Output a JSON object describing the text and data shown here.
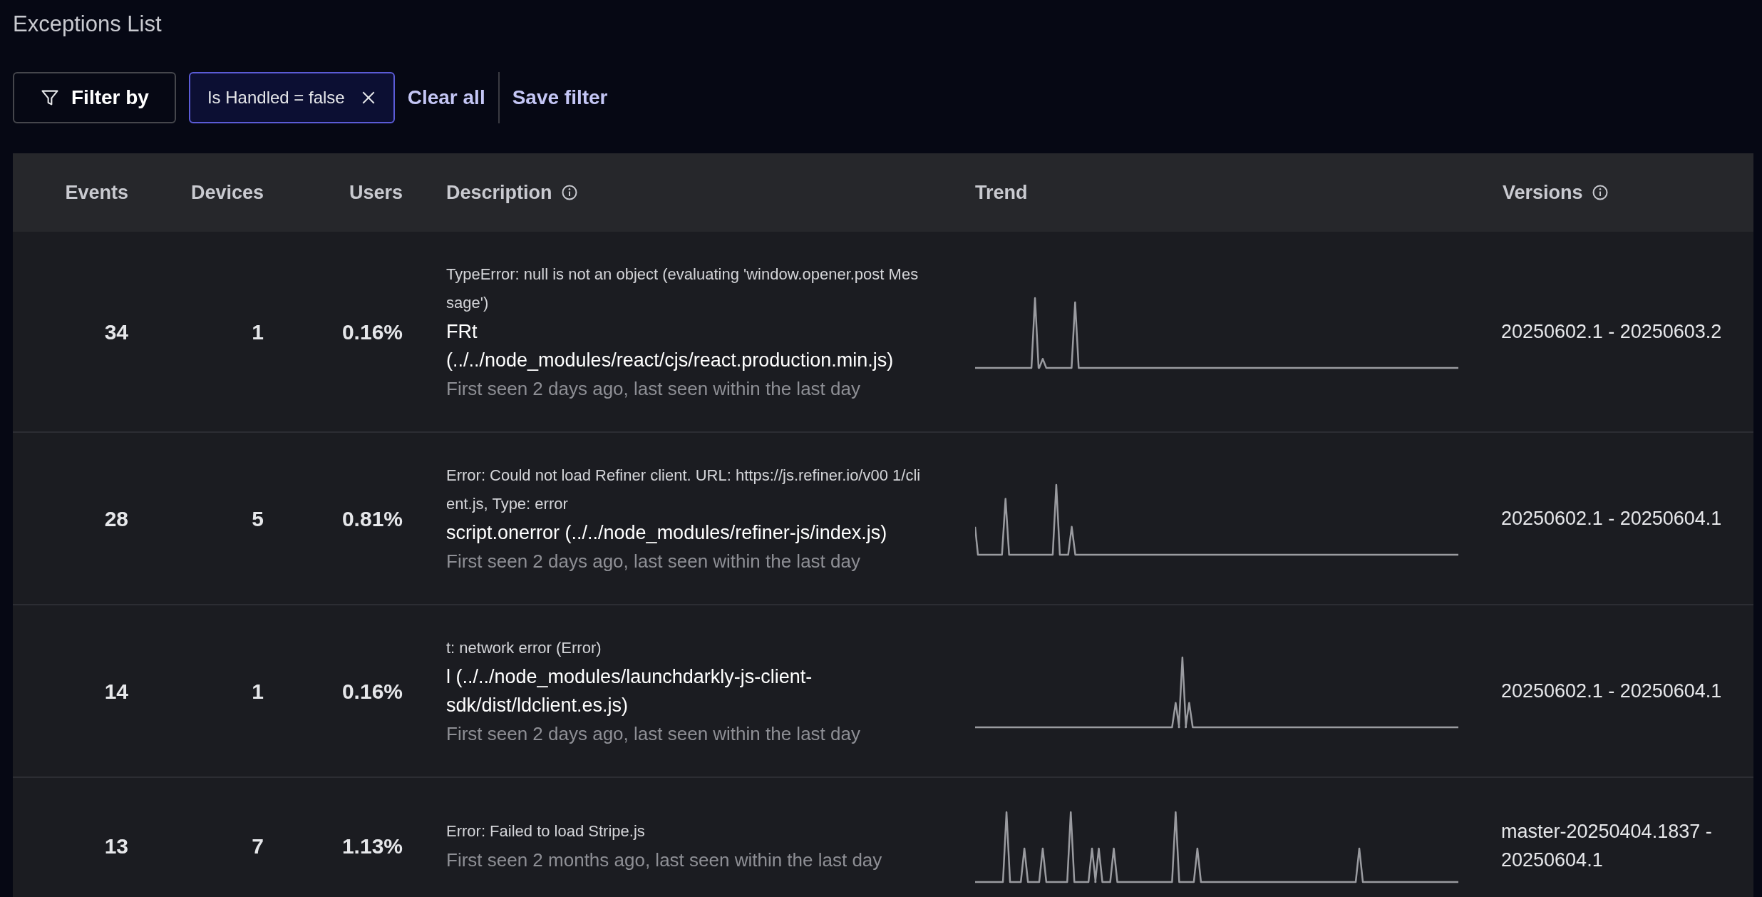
{
  "page_title": "Exceptions List",
  "filters": {
    "filter_button": "Filter by",
    "chips": [
      {
        "label": "Is Handled = false"
      }
    ],
    "clear_all": "Clear all",
    "save_filter": "Save filter"
  },
  "table": {
    "columns": [
      {
        "label": "Events",
        "info": false
      },
      {
        "label": "Devices",
        "info": false
      },
      {
        "label": "Users",
        "info": false
      },
      {
        "label": "Description",
        "info": true
      },
      {
        "label": "Trend",
        "info": false
      },
      {
        "label": "Versions",
        "info": true
      }
    ],
    "rows": [
      {
        "events": "34",
        "devices": "1",
        "users": "0.16%",
        "message": "TypeError: null is not an object (evaluating 'window.opener.post Message')",
        "source": "FRt (../../node_modules/react/cjs/react.production.min.js)",
        "seen": "First seen 2 days ago, last seen within the last day",
        "versions": "20250602.1 - 20250603.2"
      },
      {
        "events": "28",
        "devices": "5",
        "users": "0.81%",
        "message": "Error: Could not load Refiner client. URL: https://js.refiner.io/v00 1/client.js, Type: error",
        "source": "script.onerror (../../node_modules/refiner-js/index.js)",
        "seen": "First seen 2 days ago, last seen within the last day",
        "versions": "20250602.1 - 20250604.1"
      },
      {
        "events": "14",
        "devices": "1",
        "users": "0.16%",
        "message": "t: network error (Error)",
        "source": "l (../../node_modules/launchdarkly-js-client-sdk/dist/ldclient.es.js)",
        "seen": "First seen 2 days ago, last seen within the last day",
        "versions": "20250602.1 - 20250604.1"
      },
      {
        "events": "13",
        "devices": "7",
        "users": "1.13%",
        "message": "Error: Failed to load Stripe.js",
        "seen": "First seen 2 months ago, last seen within the last day",
        "versions": "master-20250404.1837 - 20250604.1"
      }
    ]
  }
}
